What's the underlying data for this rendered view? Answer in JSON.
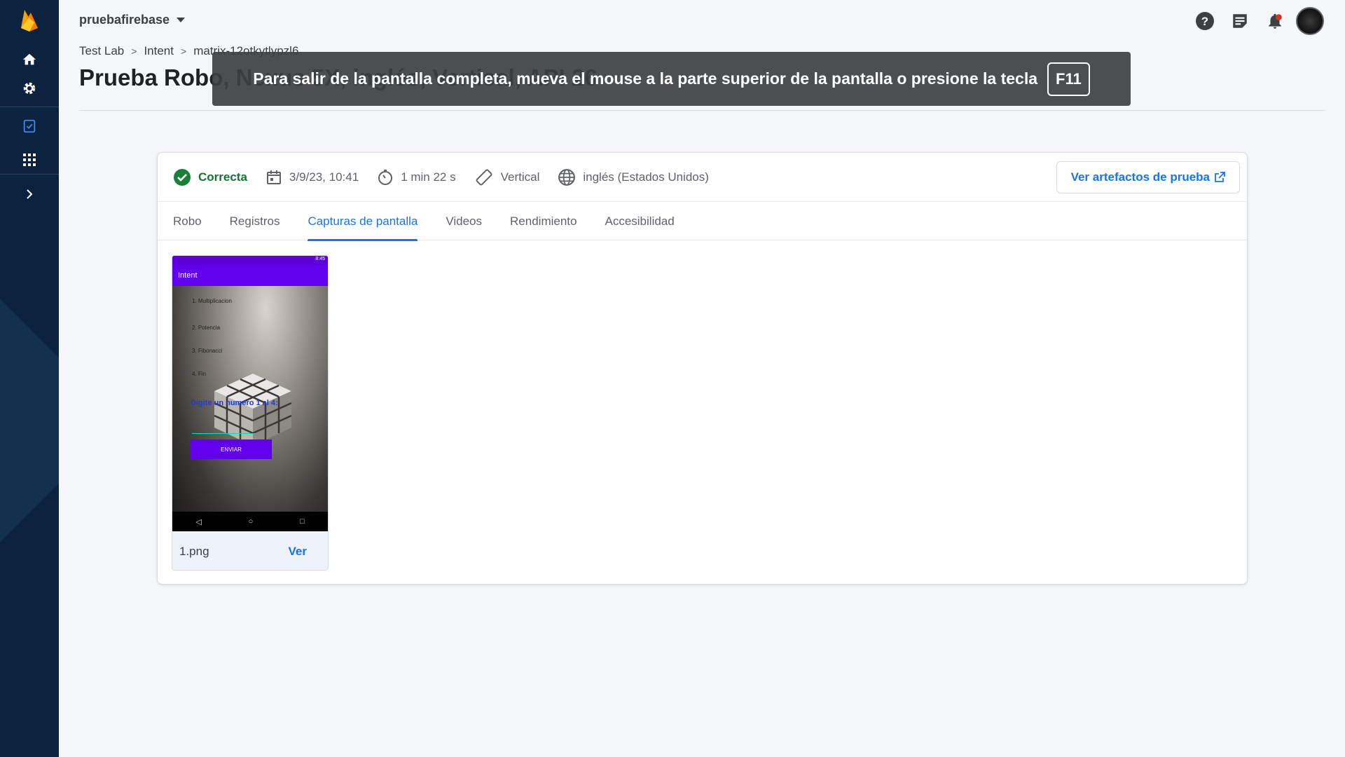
{
  "project": {
    "name": "pruebafirebase"
  },
  "breadcrumb": [
    "Test Lab",
    "Intent",
    "matrix-12otkytlypzl6"
  ],
  "page": {
    "title": "Prueba Robo, Nexus 5X, inglés, Vertical, API 26"
  },
  "toast": {
    "message": "Para salir de la pantalla completa, mueva el mouse a la parte superior de la pantalla o presione la tecla",
    "key": "F11"
  },
  "meta": {
    "status": "Correcta",
    "date": "3/9/23, 10:41",
    "duration": "1 min 22 s",
    "orientation": "Vertical",
    "locale": "inglés (Estados Unidos)"
  },
  "artifacts_button": "Ver artefactos de prueba",
  "tabs": [
    "Robo",
    "Registros",
    "Capturas de pantalla",
    "Videos",
    "Rendimiento",
    "Accesibilidad"
  ],
  "active_tab": "Capturas de pantalla",
  "screenshot": {
    "filename": "1.png",
    "view_label": "Ver",
    "app_title": "Intent",
    "status_time": "8:45",
    "menu_items": [
      "1. Multiplicacion",
      "2. Potencia",
      "3. Fibonacci",
      "4. Fin"
    ],
    "prompt": "Digite un numero 1 al 4:",
    "button": "ENVIAR"
  },
  "colors": {
    "sidebar": "#0c2340",
    "accent": "#1a73e8",
    "success": "#137333",
    "app_purple": "#6200ee"
  }
}
